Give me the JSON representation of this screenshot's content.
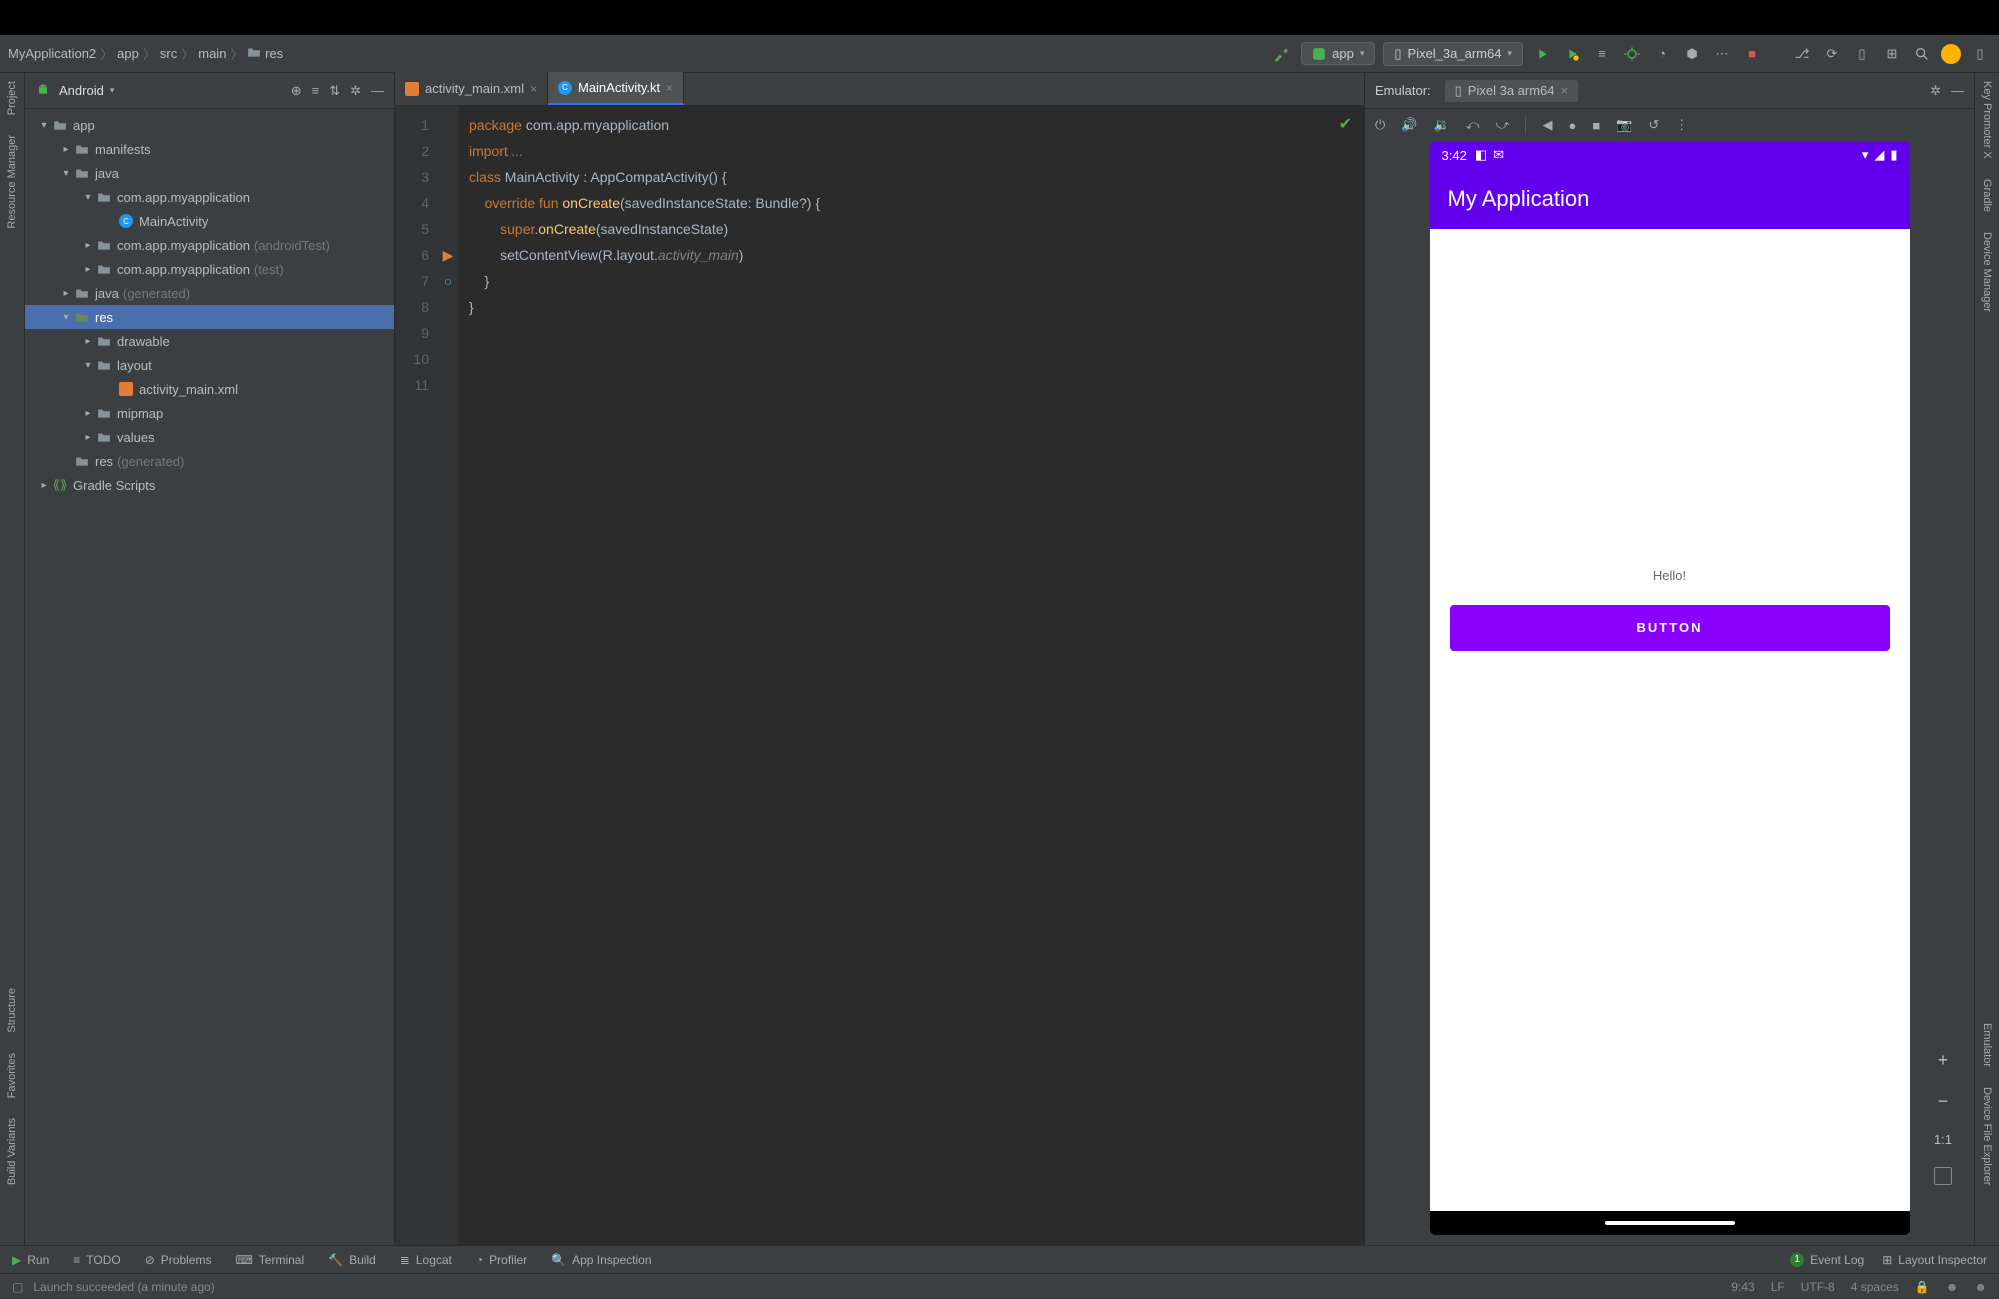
{
  "breadcrumb": [
    "MyApplication2",
    "app",
    "src",
    "main",
    "res"
  ],
  "toolbar": {
    "run_config": "app",
    "device": "Pixel_3a_arm64"
  },
  "project_panel": {
    "label": "Android",
    "gutter_tabs": {
      "project": "Project",
      "resource": "Resource Manager",
      "structure": "Structure",
      "favorites": "Favorites",
      "build": "Build Variants"
    },
    "tree": [
      {
        "depth": 0,
        "chev": "▾",
        "icon": "module",
        "label": "app"
      },
      {
        "depth": 1,
        "chev": "▸",
        "icon": "folder",
        "label": "manifests"
      },
      {
        "depth": 1,
        "chev": "▾",
        "icon": "folder",
        "label": "java"
      },
      {
        "depth": 2,
        "chev": "▾",
        "icon": "pkg",
        "label": "com.app.myapplication"
      },
      {
        "depth": 3,
        "chev": "",
        "icon": "kt",
        "label": "MainActivity"
      },
      {
        "depth": 2,
        "chev": "▸",
        "icon": "pkg",
        "label": "com.app.myapplication",
        "dim": "(androidTest)"
      },
      {
        "depth": 2,
        "chev": "▸",
        "icon": "pkg",
        "label": "com.app.myapplication",
        "dim": "(test)"
      },
      {
        "depth": 1,
        "chev": "▸",
        "icon": "folder-gen",
        "label": "java",
        "dim": "(generated)"
      },
      {
        "depth": 1,
        "chev": "▾",
        "icon": "folder-res",
        "label": "res",
        "selected": true
      },
      {
        "depth": 2,
        "chev": "▸",
        "icon": "folder",
        "label": "drawable"
      },
      {
        "depth": 2,
        "chev": "▾",
        "icon": "folder",
        "label": "layout"
      },
      {
        "depth": 3,
        "chev": "",
        "icon": "xml",
        "label": "activity_main.xml"
      },
      {
        "depth": 2,
        "chev": "▸",
        "icon": "folder",
        "label": "mipmap"
      },
      {
        "depth": 2,
        "chev": "▸",
        "icon": "folder",
        "label": "values"
      },
      {
        "depth": 1,
        "chev": "",
        "icon": "folder-gen",
        "label": "res",
        "dim": "(generated)"
      },
      {
        "depth": 0,
        "chev": "▸",
        "icon": "gradle",
        "label": "Gradle Scripts"
      }
    ]
  },
  "editor": {
    "tabs": [
      {
        "icon": "xml",
        "label": "activity_main.xml",
        "active": false
      },
      {
        "icon": "kt",
        "label": "MainActivity.kt",
        "active": true
      }
    ],
    "lines": [
      {
        "n": 1,
        "t": [
          [
            "kw",
            "package "
          ],
          [
            "id",
            "com.app.myapplication"
          ]
        ]
      },
      {
        "n": 2,
        "t": [
          [
            "",
            ""
          ]
        ]
      },
      {
        "n": 3,
        "t": [
          [
            "kw",
            "import "
          ],
          [
            "it",
            "..."
          ]
        ]
      },
      {
        "n": 4,
        "t": [
          [
            "",
            ""
          ]
        ]
      },
      {
        "n": 5,
        "t": [
          [
            "",
            ""
          ]
        ]
      },
      {
        "n": 6,
        "t": [
          [
            "kw",
            "class "
          ],
          [
            "id",
            "MainActivity : AppCompatActivity() {"
          ]
        ],
        "mark": "run"
      },
      {
        "n": 7,
        "t": [
          [
            "id",
            "    "
          ],
          [
            "kw",
            "override fun "
          ],
          [
            "fn",
            "onCreate"
          ],
          [
            "id",
            "(savedInstanceState: Bundle?) {"
          ]
        ],
        "mark": "over"
      },
      {
        "n": 8,
        "t": [
          [
            "id",
            "        "
          ],
          [
            "kw",
            "super"
          ],
          [
            "id",
            "."
          ],
          [
            "fn",
            "onCreate"
          ],
          [
            "id",
            "(savedInstanceState)"
          ]
        ]
      },
      {
        "n": 9,
        "t": [
          [
            "id",
            "        setContentView(R.layout."
          ],
          [
            "it",
            "activity_main"
          ],
          [
            "id",
            ")"
          ]
        ]
      },
      {
        "n": 10,
        "t": [
          [
            "id",
            "    }"
          ]
        ]
      },
      {
        "n": 11,
        "t": [
          [
            "id",
            "}"
          ]
        ]
      }
    ]
  },
  "emulator": {
    "panel_label": "Emulator:",
    "device_tab": "Pixel 3a arm64",
    "status_time": "3:42",
    "app_title": "My Application",
    "body_text": "Hello!",
    "button_label": "BUTTON",
    "side": {
      "ratio": "1:1"
    }
  },
  "right_gutter": {
    "keypromoter": "Key Promoter X",
    "gradle": "Gradle",
    "devicemgr": "Device Manager",
    "emulator": "Emulator",
    "devexplorer": "Device File Explorer"
  },
  "bottombar": {
    "items": [
      "Run",
      "TODO",
      "Problems",
      "Terminal",
      "Build",
      "Logcat",
      "Profiler",
      "App Inspection"
    ],
    "right": {
      "eventlog": "Event Log",
      "layoutinsp": "Layout Inspector"
    }
  },
  "footer": {
    "msg": "Launch succeeded (a minute ago)",
    "right": [
      "9:43",
      "LF",
      "UTF-8",
      "4 spaces"
    ]
  }
}
